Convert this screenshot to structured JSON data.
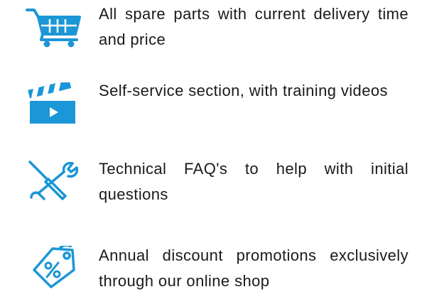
{
  "theme": {
    "icon_color": "#1b96d6"
  },
  "features": [
    {
      "icon": "shopping-cart-icon",
      "text": "All spare parts with current delivery time and price"
    },
    {
      "icon": "clapperboard-video-icon",
      "text": "Self-service section, with training videos"
    },
    {
      "icon": "wrench-screwdriver-icon",
      "text": "Technical FAQ's to help with initial questions"
    },
    {
      "icon": "discount-tag-icon",
      "text": "Annual discount promotions exclusively through our online shop"
    }
  ]
}
